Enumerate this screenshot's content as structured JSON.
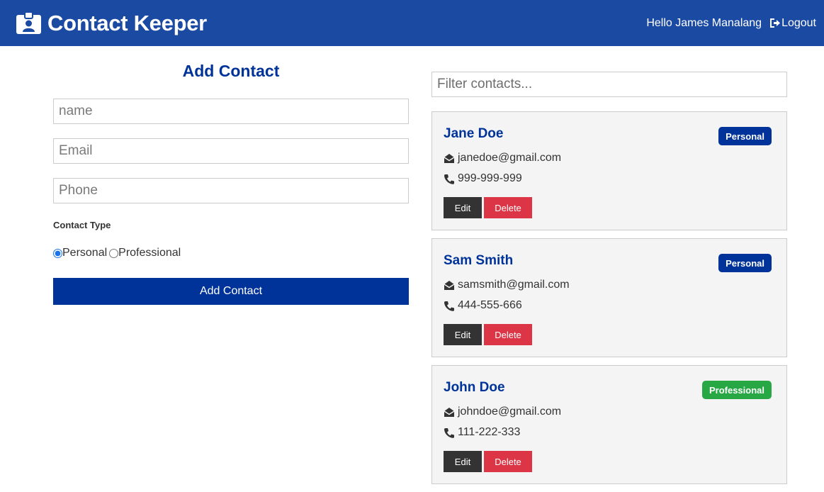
{
  "navbar": {
    "brand_icon": "id-badge-icon",
    "title": "Contact Keeper",
    "greeting": "Hello James Manalang",
    "logout_label": "Logout",
    "logout_icon": "sign-out-icon",
    "background": "#1b4aa3"
  },
  "form": {
    "title": "Add Contact",
    "name_placeholder": "name",
    "email_placeholder": "Email",
    "phone_placeholder": "Phone",
    "type_label": "Contact Type",
    "radio_personal": "Personal",
    "radio_professional": "Professional",
    "selected_type": "Personal",
    "submit_label": "Add Contact",
    "accent": "#003399"
  },
  "filter": {
    "placeholder": "Filter contacts..."
  },
  "contacts": [
    {
      "name": "Jane Doe",
      "email": "janedoe@gmail.com",
      "phone": "999-999-999",
      "type": "Personal",
      "badge_color": "#003399"
    },
    {
      "name": "Sam Smith",
      "email": "samsmith@gmail.com",
      "phone": "444-555-666",
      "type": "Personal",
      "badge_color": "#003399"
    },
    {
      "name": "John Doe",
      "email": "johndoe@gmail.com",
      "phone": "111-222-333",
      "type": "Professional",
      "badge_color": "#28a745"
    }
  ],
  "card_buttons": {
    "edit_label": "Edit",
    "delete_label": "Delete",
    "delete_color": "#dc3545"
  },
  "icons": {
    "email": "envelope-open-icon",
    "phone": "phone-icon"
  }
}
